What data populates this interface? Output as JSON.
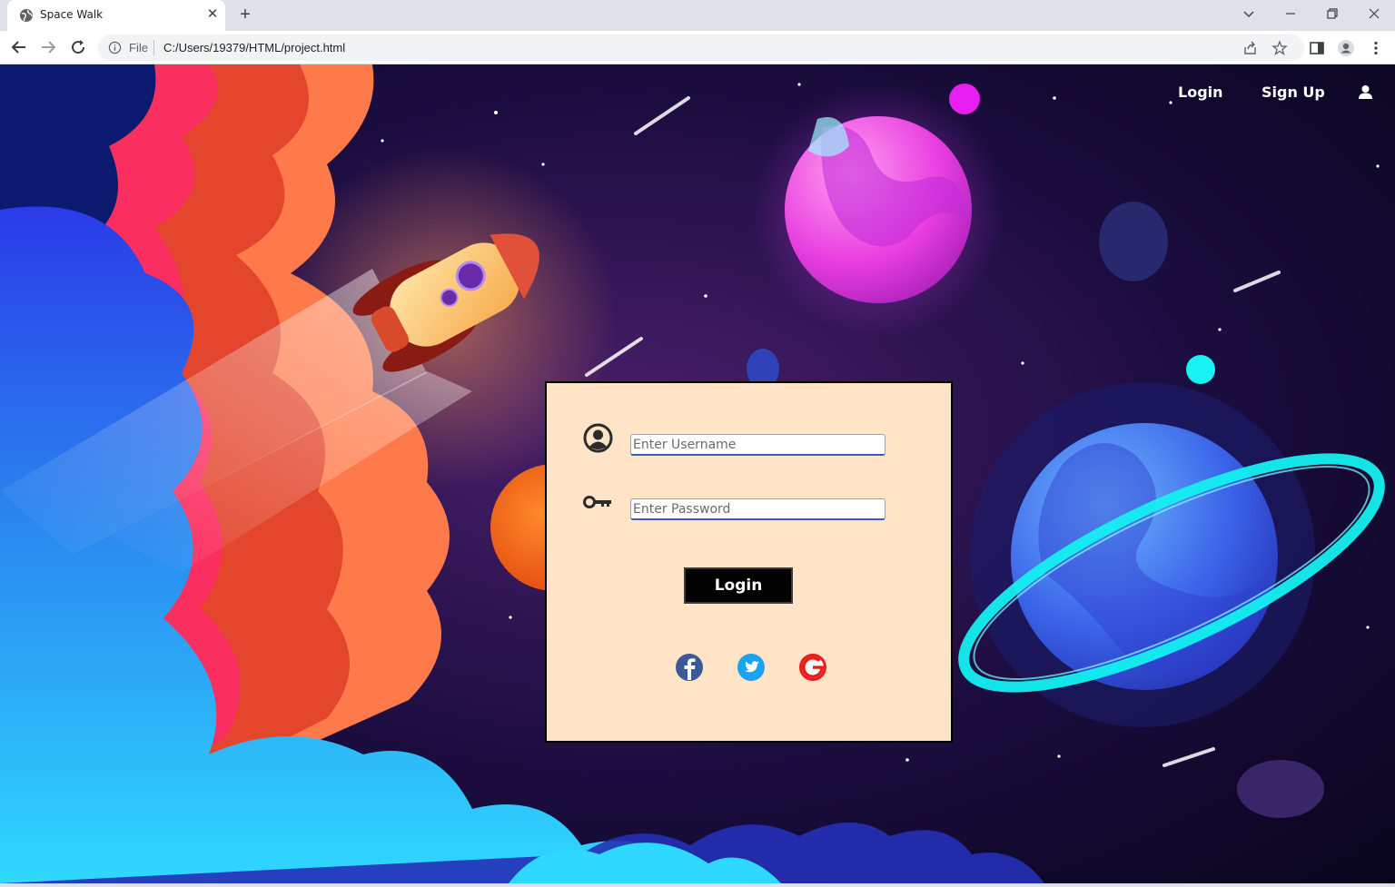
{
  "browser": {
    "tab_title": "Space Walk",
    "tab_close": "✕",
    "new_tab": "+",
    "file_label": "File",
    "url": "C:/Users/19379/HTML/project.html"
  },
  "site_nav": {
    "login_label": "Login",
    "signup_label": "Sign Up",
    "user_icon": "user-icon"
  },
  "login_form": {
    "username_placeholder": "Enter Username",
    "password_placeholder": "Enter Password",
    "username_icon": "user-circle-icon",
    "password_icon": "key-icon",
    "submit_label": "Login",
    "social": [
      {
        "name": "facebook",
        "color": "#3b5998"
      },
      {
        "name": "twitter",
        "color": "#1da1f2"
      },
      {
        "name": "google",
        "color": "#ea1c1c"
      }
    ]
  },
  "colors": {
    "form_bg": "#ffe4c8",
    "button_bg": "#000000",
    "nav_text": "#ffffff"
  }
}
